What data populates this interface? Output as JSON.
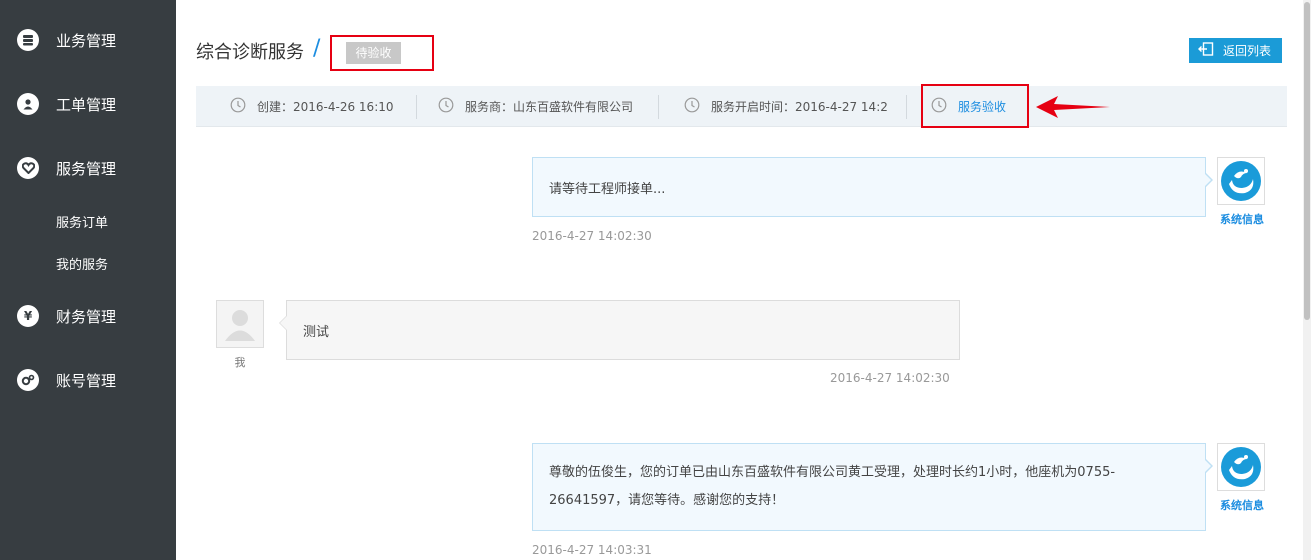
{
  "sidebar": {
    "items": [
      {
        "label": "业务管理",
        "icon": "database-icon"
      },
      {
        "label": "工单管理",
        "icon": "user-icon"
      },
      {
        "label": "服务管理",
        "icon": "heart-icon"
      },
      {
        "label": "财务管理",
        "icon": "yen-icon"
      },
      {
        "label": "账号管理",
        "icon": "gears-icon"
      }
    ],
    "sub_items": [
      {
        "label": "服务订单"
      },
      {
        "label": "我的服务"
      }
    ]
  },
  "header": {
    "title": "综合诊断服务",
    "separator": "/",
    "status": "待验收",
    "back_label": "返回列表"
  },
  "info_bar": {
    "created": "创建：2016-4-26 16:10",
    "provider": "服务商：山东百盛软件有限公司",
    "start_time": "服务开启时间：2016-4-27 14:2",
    "accept": "服务验收"
  },
  "messages": [
    {
      "sender": "系统信息",
      "text": "请等待工程师接单...",
      "time": "2016-4-27 14:02:30"
    },
    {
      "sender": "我",
      "text": "测试",
      "time": "2016-4-27 14:02:30"
    },
    {
      "sender": "系统信息",
      "text_line1": "尊敬的伍俊生，您的订单已由山东百盛软件有限公司黄工受理，处理时长约1小时，他座机为0755-",
      "text_line2": "26641597，请您等待。感谢您的支持！",
      "time": "2016-4-27 14:03:31"
    }
  ],
  "colors": {
    "sidebar_bg": "#373d41",
    "accent": "#1c8de0",
    "highlight": "#e60012"
  }
}
